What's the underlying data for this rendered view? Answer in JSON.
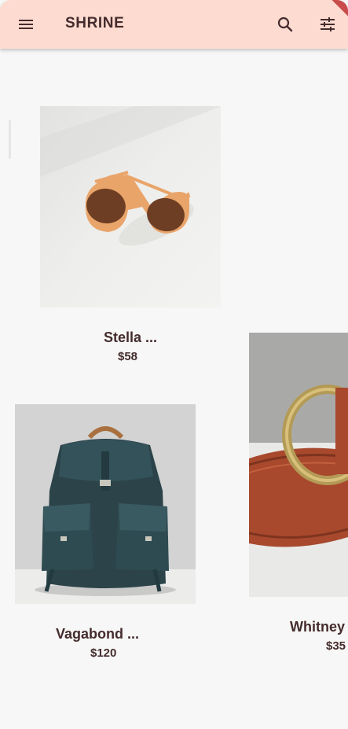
{
  "app": {
    "title": "SHRINE",
    "debug_banner": "DEBUG",
    "icons": {
      "menu": "menu-icon",
      "search": "search-icon",
      "filter": "tune-icon"
    }
  },
  "colors": {
    "appbar": "#FEDBD0",
    "text": "#442B2D",
    "background": "#F6F7F6"
  },
  "products": [
    {
      "name": "Stella ...",
      "price": "$58"
    },
    {
      "name": "Vagabond ...",
      "price": "$120"
    },
    {
      "name": "Whitney",
      "price": "$35"
    }
  ]
}
